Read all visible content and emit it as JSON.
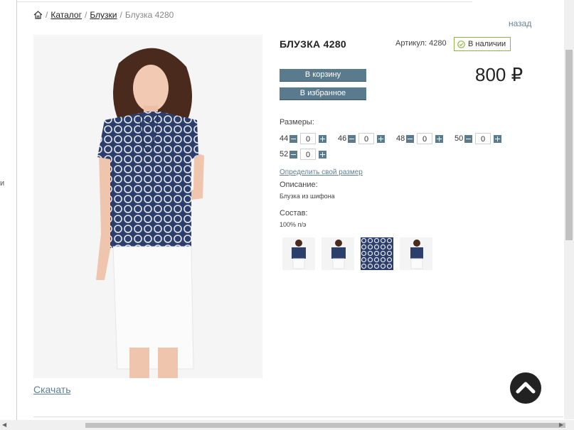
{
  "breadcrumb": {
    "items": [
      {
        "label": "Каталог"
      },
      {
        "label": "Блузки"
      }
    ],
    "current": "Блузка 4280",
    "separator": "/"
  },
  "back_label": "назад",
  "left_edge_glyph": "и",
  "product": {
    "title": "БЛУЗКА 4280",
    "sku_label": "Артикул: 4280",
    "stock_label": "В наличии",
    "price": "800 ₽",
    "cart_button": "В корзину",
    "favorite_button": "В избранное",
    "sizes_label": "Размеры:",
    "sizes": [
      {
        "size": "44",
        "qty": "0"
      },
      {
        "size": "46",
        "qty": "0"
      },
      {
        "size": "48",
        "qty": "0"
      },
      {
        "size": "50",
        "qty": "0"
      },
      {
        "size": "52",
        "qty": "0"
      }
    ],
    "define_size_link": "Определить свой размер",
    "description_label": "Описание:",
    "description": "Блузка из шифона",
    "composition_label": "Состав:",
    "composition": "100% п/э",
    "download_link": "Скачать"
  },
  "colors": {
    "accent": "#5a7b8d",
    "stock_border": "#8fb24a",
    "blouse_navy": "#2c3e6b",
    "link": "#5f7f93"
  },
  "icons": {
    "home": "home-icon",
    "stock": "check-circle-icon",
    "to_top": "chevron-up-icon"
  }
}
